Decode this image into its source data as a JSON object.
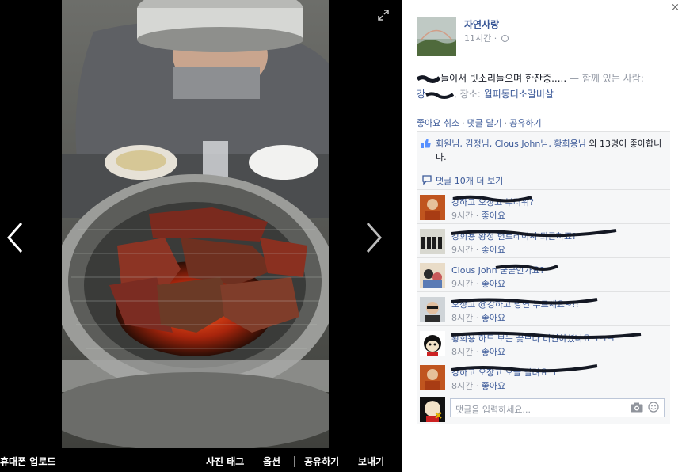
{
  "photo_view": {
    "expand_icon": "expand-icon",
    "prev_icon": "chevron-left-icon",
    "next_icon": "chevron-right-icon",
    "bottom_bar": {
      "upload_label": "휴대폰 업로드",
      "tag_label": "사진 태그",
      "options_label": "옵션",
      "share_label": "공유하기",
      "send_label": "보내기"
    }
  },
  "panel": {
    "close_label": "×",
    "page_name": "자연사랑",
    "time": "11시간 ·",
    "post": {
      "text_main": "들이서 빗소리들으며 한잔중.....",
      "with_label": "— 함께 있는 사람:",
      "friend_prefix": "강",
      "place_prefix": ", 장소:",
      "place": "월피동더소갈비살"
    },
    "actions": {
      "unlike": "좋아요 취소",
      "comment": "댓글 달기",
      "share": "공유하기",
      "sep": "·"
    },
    "likes": {
      "names": "회원님, 김정님, Clous John님, 황희용님",
      "suffix": "외 13명이 좋아합니다."
    },
    "more_comments": "댓글 10개 더 보기",
    "comments": [
      {
        "name": "강하고 오창고 부러워?",
        "time": "9시간",
        "like": "좋아요"
      },
      {
        "name": "강희용 황정 헌트레이시 퇴근하죠?",
        "time": "9시간",
        "like": "좋아요"
      },
      {
        "name": "Clous John 굳굳인가요?",
        "time": "9시간",
        "like": "좋아요"
      },
      {
        "name": "오창고 @강하고 당연 부르세요~!!",
        "time": "8시간",
        "like": "좋아요"
      },
      {
        "name": "황희용 하드 보는 꽃보다 비인하셨나요ㅋㅋㅋ",
        "time": "8시간",
        "like": "좋아요"
      },
      {
        "name": "강하고 오창고 오늘 달려요 ㅜ",
        "time": "8시간",
        "like": "좋아요"
      }
    ],
    "reply_placeholder": "댓글을 입력하세요...",
    "reply_icons": [
      "camera-icon",
      "smiley-icon"
    ]
  },
  "colors": {
    "link": "#3b5998",
    "meta": "#9197a3",
    "ufi_bg": "#f6f7f8",
    "stage_bg": "#000000"
  }
}
